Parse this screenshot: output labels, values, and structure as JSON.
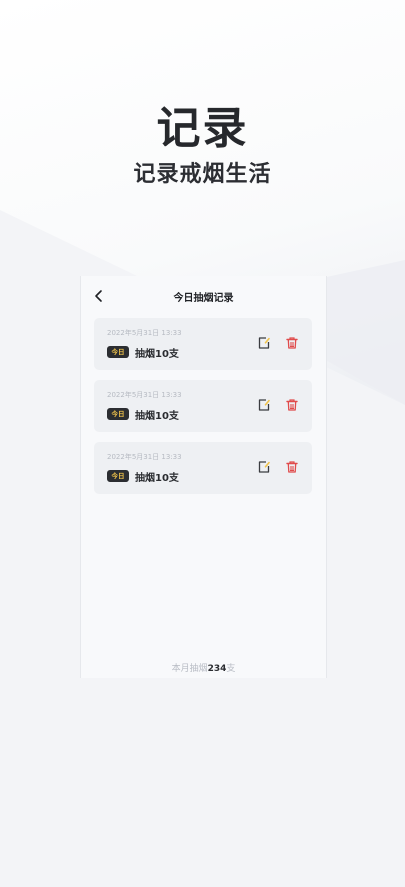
{
  "hero": {
    "title": "记录",
    "subtitle": "记录戒烟生活"
  },
  "screen": {
    "title": "今日抽烟记录",
    "records": [
      {
        "time": "2022年5月31日 13:33",
        "tag": "今日",
        "text": "抽烟10支"
      },
      {
        "time": "2022年5月31日 13:33",
        "tag": "今日",
        "text": "抽烟10支"
      },
      {
        "time": "2022年5月31日 13:33",
        "tag": "今日",
        "text": "抽烟10支"
      }
    ],
    "summary": {
      "prefix": "本月抽烟",
      "count": "234",
      "suffix": "支"
    }
  },
  "colors": {
    "tag_bg": "#2b2d31",
    "tag_text": "#f1c44c",
    "delete": "#e04b4b",
    "edit_accent": "#f1c44c"
  }
}
